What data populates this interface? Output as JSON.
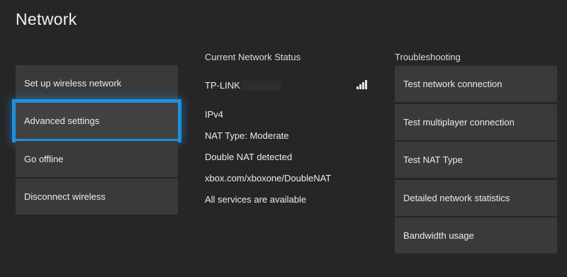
{
  "page": {
    "title": "Network"
  },
  "left_menu": {
    "items": [
      {
        "label": "Set up wireless network"
      },
      {
        "label": "Advanced settings"
      },
      {
        "label": "Go offline"
      },
      {
        "label": "Disconnect wireless"
      }
    ]
  },
  "status": {
    "heading": "Current Network Status",
    "network_name": "TP-LINK",
    "signal_icon": "signal-strength-icon",
    "ip_version": "IPv4",
    "nat_type": "NAT Type: Moderate",
    "double_nat": "Double NAT detected",
    "help_link": "xbox.com/xboxone/DoubleNAT",
    "services": "All services are available"
  },
  "troubleshooting": {
    "heading": "Troubleshooting",
    "items": [
      {
        "label": "Test network connection"
      },
      {
        "label": "Test multiplayer connection"
      },
      {
        "label": "Test NAT Type"
      },
      {
        "label": "Detailed network statistics"
      },
      {
        "label": "Bandwidth usage"
      }
    ]
  },
  "colors": {
    "background": "#262626",
    "tile": "#3a3a3a",
    "focus_accent": "#1f8fe0"
  }
}
